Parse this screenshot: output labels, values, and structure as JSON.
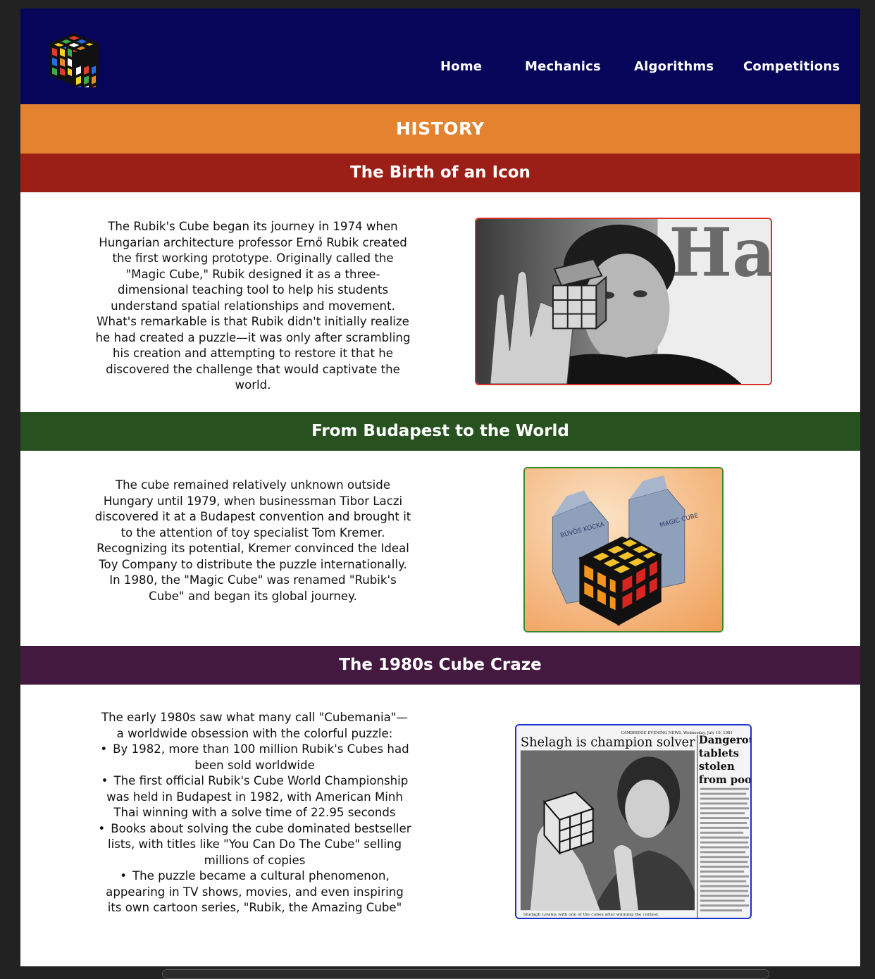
{
  "nav": {
    "links": [
      "Home",
      "Mechanics",
      "Algorithms",
      "Competitions"
    ]
  },
  "page_title": "HISTORY",
  "sections": [
    {
      "heading": "The Birth of an Icon",
      "text": "The Rubik's Cube began its journey in 1974 when Hungarian architecture professor Ernő Rubik created the first working prototype. Originally called the \"Magic Cube,\" Rubik designed it as a three-dimensional teaching tool to help his students understand spatial relationships and movement. What's remarkable is that Rubik didn't initially realize he had created a puzzle—it was only after scrambling his creation and attempting to restore it that he discovered the challenge that would captivate the world.",
      "color": "#9b1f17",
      "frame_color": "#d9302b"
    },
    {
      "heading": "From Budapest to the World",
      "text": "The cube remained relatively unknown outside Hungary until 1979, when businessman Tibor Laczi discovered it at a Budapest convention and brought it to the attention of toy specialist Tom Kremer. Recognizing its potential, Kremer convinced the Ideal Toy Company to distribute the puzzle internationally. In 1980, the \"Magic Cube\" was renamed \"Rubik's Cube\" and began its global journey.",
      "color": "#275220",
      "frame_color": "#3a8a2a"
    },
    {
      "heading": "The 1980s Cube Craze",
      "intro": "The early 1980s saw what many call \"Cubemania\"—a worldwide obsession with the colorful puzzle:",
      "items": [
        "By 1982, more than 100 million Rubik's Cubes had been sold worldwide",
        "The first official Rubik's Cube World Championship was held in Budapest in 1982, with American Minh Thai winning with a solve time of 22.95 seconds",
        "Books about solving the cube dominated bestseller lists, with titles like \"You Can Do The Cube\" selling millions of copies",
        "The puzzle became a cultural phenomenon, appearing in TV shows, movies, and even inspiring its own cartoon series, \"Rubik, the Amazing Cube\""
      ],
      "color": "#43193f",
      "frame_color": "#1a2fd0"
    }
  ],
  "images": {
    "photo1_sign_text": "Har",
    "photo2_box_text_left": "BŰVÖS KOCKA",
    "photo2_box_text_right": "MAGIC CUBE",
    "newspaper_masthead": "CAMBRIDGE EVENING NEWS, Wednesday, July 15, 1981",
    "newspaper_headline": "Shelagh is champion solver",
    "newspaper_side_headline": "Dangerous tablets stolen from poo",
    "newspaper_caption": "Shelagh Lewins with one of the cubes after winning the contest."
  }
}
